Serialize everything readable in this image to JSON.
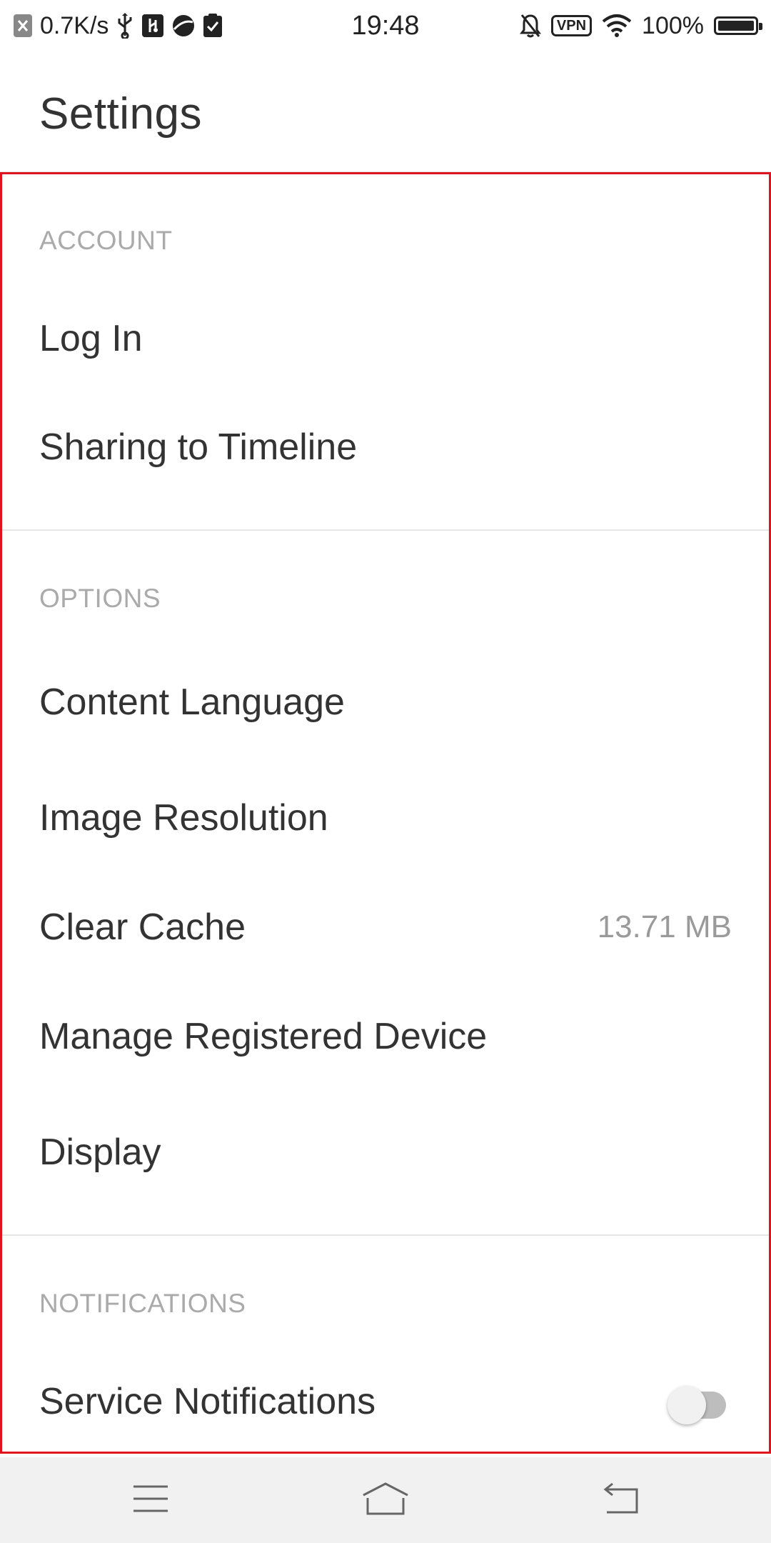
{
  "status_bar": {
    "net_speed": "0.7K/s",
    "time": "19:48",
    "vpn": "VPN",
    "battery_percent": "100%",
    "battery_level": 1.0,
    "left_icons": [
      "close-notification-icon",
      "usb-icon",
      "usb-debug-icon",
      "planet-app-icon",
      "clipboard-check-icon"
    ],
    "right_icons": [
      "bell-off-icon",
      "vpn-icon",
      "wifi-icon",
      "battery-icon"
    ]
  },
  "header": {
    "title": "Settings"
  },
  "sections": {
    "account": {
      "title": "ACCOUNT",
      "items": [
        {
          "label": "Log In"
        },
        {
          "label": "Sharing to Timeline"
        }
      ]
    },
    "options": {
      "title": "OPTIONS",
      "items": [
        {
          "label": "Content Language"
        },
        {
          "label": "Image Resolution"
        },
        {
          "label": "Clear Cache",
          "value": "13.71 MB"
        },
        {
          "label": "Manage Registered Device"
        },
        {
          "label": "Display"
        }
      ]
    },
    "notifications": {
      "title": "NOTIFICATIONS",
      "items": [
        {
          "label": "Service Notifications",
          "toggle_on": false
        }
      ]
    }
  },
  "nav_bar": {
    "buttons": [
      "menu-icon",
      "home-icon",
      "back-icon"
    ]
  },
  "colors": {
    "highlight_border": "#e0141f",
    "section_header": "#aaaaaa",
    "text": "#333333",
    "value_text": "#9a9a9a",
    "nav_bg": "#f1f1f1"
  }
}
